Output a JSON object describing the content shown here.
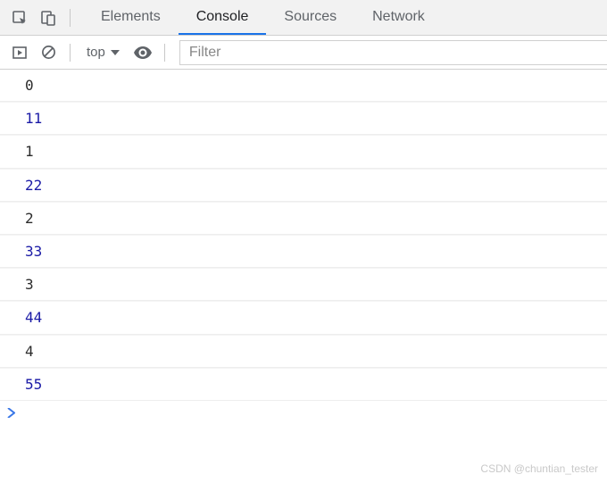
{
  "tabs": {
    "elements": "Elements",
    "console": "Console",
    "sources": "Sources",
    "network": "Network",
    "active": "console"
  },
  "toolbar": {
    "context_label": "top",
    "filter_placeholder": "Filter"
  },
  "console_logs": [
    {
      "value": "0",
      "style": "black"
    },
    {
      "value": "11",
      "style": "blue"
    },
    {
      "value": "1",
      "style": "black"
    },
    {
      "value": "22",
      "style": "blue"
    },
    {
      "value": "2",
      "style": "black"
    },
    {
      "value": "33",
      "style": "blue"
    },
    {
      "value": "3",
      "style": "black"
    },
    {
      "value": "44",
      "style": "blue"
    },
    {
      "value": "4",
      "style": "black"
    },
    {
      "value": "55",
      "style": "blue"
    }
  ],
  "watermark": "CSDN @chuntian_tester"
}
